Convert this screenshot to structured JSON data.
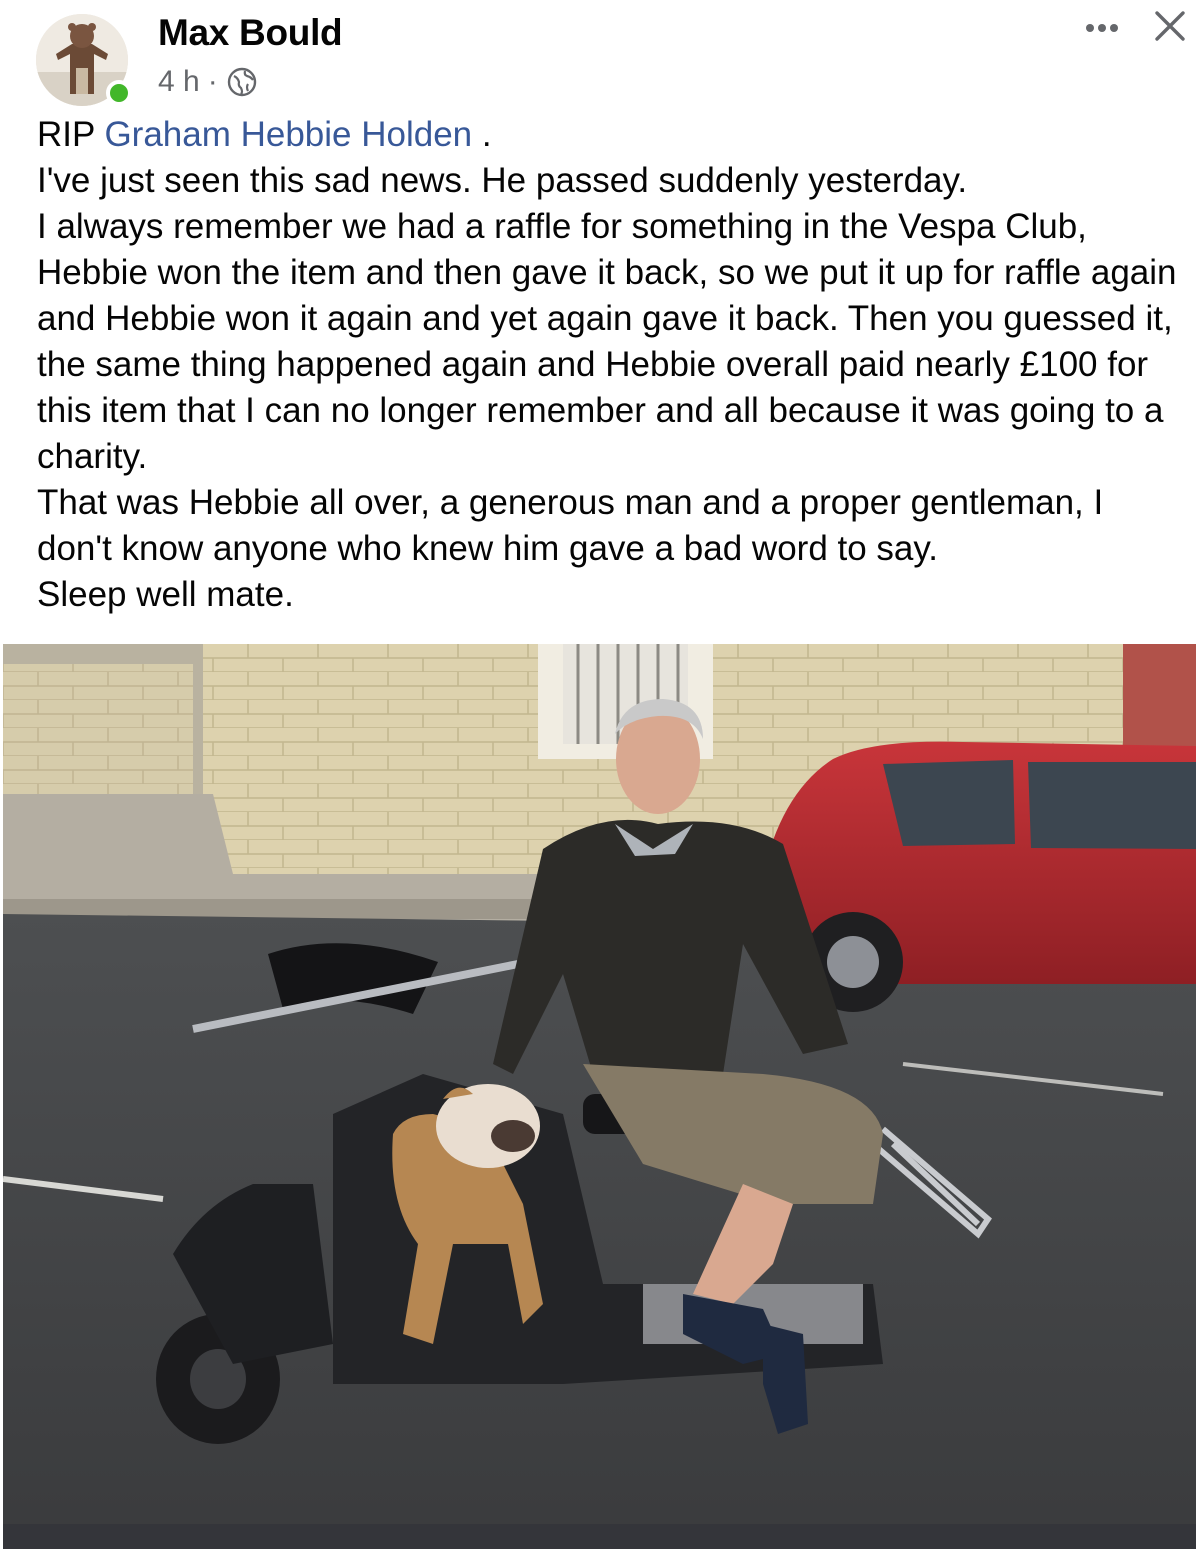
{
  "post": {
    "author": "Max Bould",
    "time": "4 h",
    "separator": "·",
    "privacy_icon": "globe-icon",
    "more_icon": "more-dots-icon",
    "close_icon": "close-icon",
    "body": {
      "line1_prefix": "RIP ",
      "mention": "Graham Hebbie Holden",
      "line1_suffix": " .",
      "line2": "I've just seen this sad news. He passed suddenly yesterday.",
      "paragraph1": "I always remember we had a raffle for something in the Vespa Club, Hebbie won the item and then gave it back, so we put it up for raffle again and Hebbie won it again and yet again gave it back. Then you guessed it, the same thing happened again and Hebbie overall paid nearly £100 for this item that I can no longer remember and all because it was going to a charity.",
      "paragraph2": "That was Hebbie all over, a generous man and a proper gentleman, I don't know anyone who knew him gave a bad word to say.",
      "line_last": "Sleep well mate."
    }
  },
  "colors": {
    "mention": "#385898",
    "online": "#42b72a",
    "meta": "#65676b"
  }
}
